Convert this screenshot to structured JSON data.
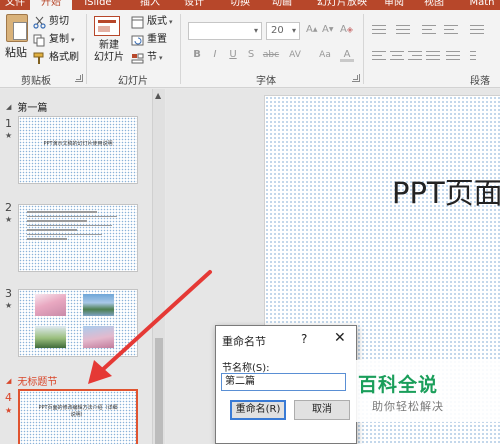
{
  "tabs": [
    "文件",
    "开始",
    "iSlide",
    "插入",
    "设计",
    "切换",
    "动画",
    "幻灯片放映",
    "审阅",
    "视图",
    "Math"
  ],
  "ribbon": {
    "clipboard": {
      "paste": "粘贴",
      "cut": "剪切",
      "copy": "复制",
      "painter": "格式刷",
      "group": "剪贴板"
    },
    "slides": {
      "new_slide": "新建\n幻灯片",
      "layout": "版式",
      "reset": "重置",
      "section": "节",
      "group": "幻灯片"
    },
    "font": {
      "font_name": "",
      "font_size": "20",
      "bold": "B",
      "italic": "I",
      "underline": "U",
      "shadow": "S",
      "strike": "abc",
      "spacing": "AV",
      "case": "Aa",
      "group": "字体"
    },
    "paragraph": {
      "group": "段落"
    }
  },
  "sections": {
    "first": "第一篇",
    "untitled": "无标题节"
  },
  "slides": [
    {
      "num": "1",
      "star": "★",
      "text": "PPT演示文稿的幻灯片使用说明"
    },
    {
      "num": "2",
      "star": "★"
    },
    {
      "num": "3",
      "star": "★"
    },
    {
      "num": "4",
      "star": "★",
      "text": "PPT页面的修改编辑方法介绍（详细说明）"
    }
  ],
  "main_slide": {
    "title": "PPT页面"
  },
  "dialog": {
    "title": "重命名节",
    "help": "?",
    "close": "✕",
    "label": "节名称(S):",
    "input_value": "第二篇",
    "rename_button": "重命名(R)",
    "cancel_button": "取消"
  },
  "watermark": {
    "logo": "百科全说",
    "tagline": "助你轻松解决"
  },
  "colors": {
    "accent": "#b7472a",
    "selection": "#e0532f",
    "arrow": "#e53935",
    "watermark": "#1a9e5a"
  }
}
